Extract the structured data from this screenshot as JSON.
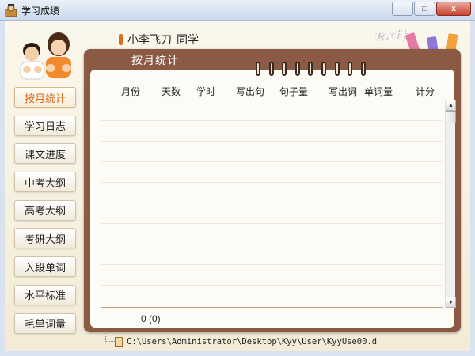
{
  "window": {
    "title": "学习成绩",
    "minimize_label": "–",
    "maximize_label": "□",
    "close_label": "x"
  },
  "user": {
    "name": "小李飞刀",
    "suffix": "同学"
  },
  "exit_label": "exit",
  "panel_title": "按月统计",
  "nav": {
    "items": [
      {
        "label": "按月统计",
        "active": true
      },
      {
        "label": "学习日志"
      },
      {
        "label": "课文进度"
      },
      {
        "label": "中考大纲"
      },
      {
        "label": "高考大纲"
      },
      {
        "label": "考研大纲"
      },
      {
        "label": "入段单词"
      },
      {
        "label": "水平标准"
      },
      {
        "label": "毛单词量"
      }
    ]
  },
  "table": {
    "columns": [
      "月份",
      "天数",
      "学时",
      "写出句",
      "句子量",
      "写出词",
      "单词量",
      "计分"
    ],
    "rows": []
  },
  "total_label": "0 (0)",
  "file_path": "C:\\Users\\Administrator\\Desktop\\Kyy\\User\\KyyUse00.d",
  "colors": {
    "frame": "#8a5a44",
    "accent": "#d96a1c",
    "paper": "#fdfbf6"
  }
}
